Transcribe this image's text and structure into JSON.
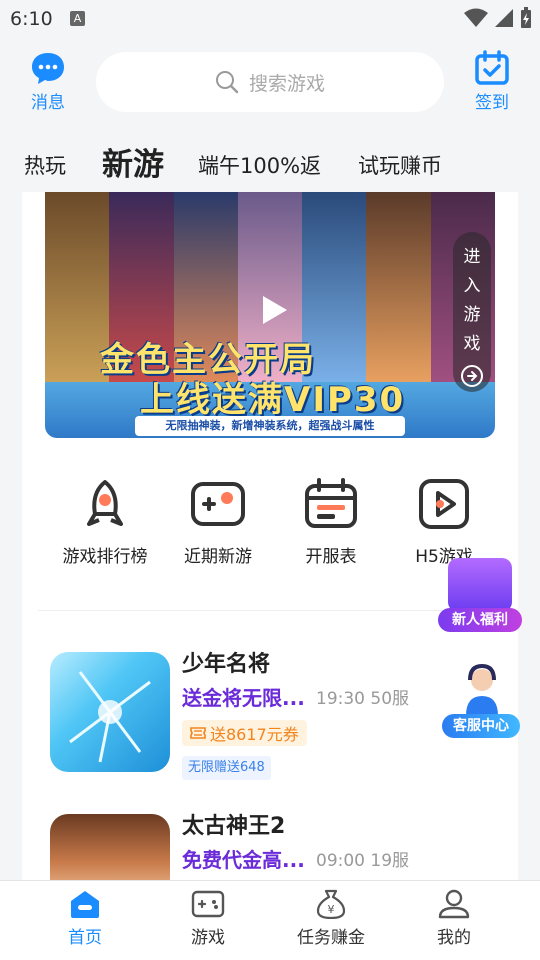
{
  "status_bar": {
    "time": "6:10",
    "notification_badge": "A"
  },
  "header": {
    "messages_label": "消息",
    "search_placeholder": "搜索游戏",
    "checkin_label": "签到",
    "accent_color": "#1a8cff"
  },
  "tabs": [
    {
      "label": "热玩"
    },
    {
      "label": "新游"
    },
    {
      "label": "端午100%返"
    },
    {
      "label": "试玩赚币"
    }
  ],
  "banner": {
    "headline_line1": "金色主公开局",
    "headline_line2": "上线送满VIP30",
    "subtitle": "无限抽神装，新增神装系统，超强战斗属性",
    "enter_chars": [
      "进",
      "入",
      "游",
      "戏"
    ]
  },
  "quick_entries": [
    {
      "label": "游戏排行榜",
      "icon": "rocket-icon"
    },
    {
      "label": "近期新游",
      "icon": "gamepad-icon"
    },
    {
      "label": "开服表",
      "icon": "calendar-icon"
    },
    {
      "label": "H5游戏",
      "icon": "play-icon"
    }
  ],
  "games": [
    {
      "name": "少年名将",
      "promo": "送金将无限...",
      "schedule": "19:30 50服",
      "coupon": "送8617元券",
      "tag": "无限赠送648"
    },
    {
      "name": "太古神王2",
      "promo": "免费代金高...",
      "schedule": "09:00 19服"
    }
  ],
  "floating": {
    "new_user_label": "新人福利",
    "support_label": "客服中心"
  },
  "bottom_nav": [
    {
      "label": "首页",
      "icon": "home-icon",
      "active": true
    },
    {
      "label": "游戏",
      "icon": "game-icon",
      "active": false
    },
    {
      "label": "任务赚金",
      "icon": "money-bag-icon",
      "active": false
    },
    {
      "label": "我的",
      "icon": "profile-icon",
      "active": false
    }
  ]
}
